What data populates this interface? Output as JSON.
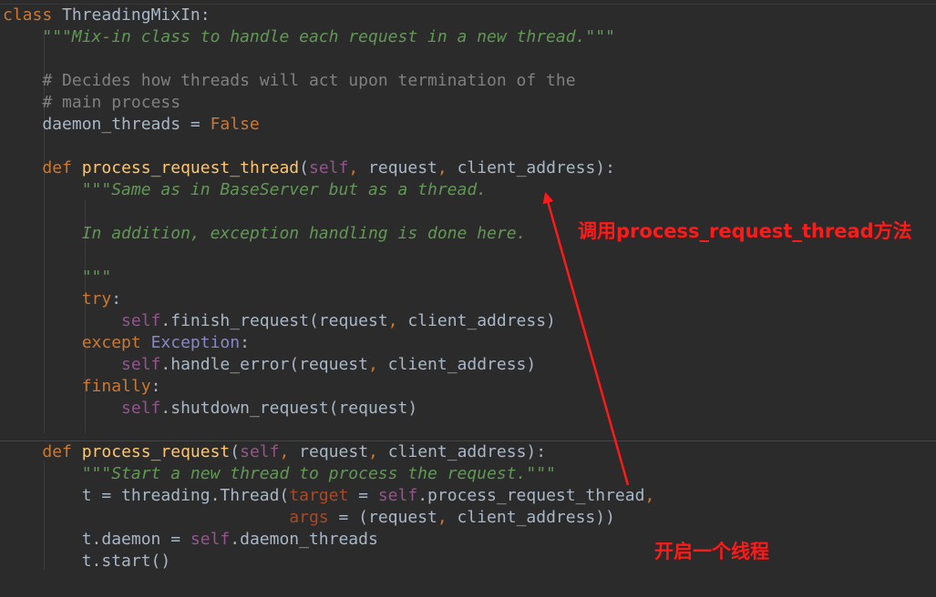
{
  "code": {
    "l1": [
      {
        "c": "kw",
        "t": "class "
      },
      {
        "c": "plain",
        "t": "ThreadingMixIn:"
      }
    ],
    "l2": [
      {
        "c": "plain",
        "t": "    "
      },
      {
        "c": "doc",
        "t": "\"\"\"Mix-in class to handle each request in a new thread.\"\"\""
      }
    ],
    "l3": [],
    "l4": [
      {
        "c": "plain",
        "t": "    "
      },
      {
        "c": "cm",
        "t": "# Decides how threads will act upon termination of the"
      }
    ],
    "l5": [
      {
        "c": "plain",
        "t": "    "
      },
      {
        "c": "cm",
        "t": "# main process"
      }
    ],
    "l6": [
      {
        "c": "plain",
        "t": "    daemon_threads = "
      },
      {
        "c": "kw",
        "t": "False"
      }
    ],
    "l7": [],
    "l8": [
      {
        "c": "plain",
        "t": "    "
      },
      {
        "c": "kw",
        "t": "def "
      },
      {
        "c": "fn",
        "t": "process_request_thread"
      },
      {
        "c": "plain",
        "t": "("
      },
      {
        "c": "slf",
        "t": "self"
      },
      {
        "c": "kw",
        "t": ", "
      },
      {
        "c": "plain",
        "t": "request"
      },
      {
        "c": "kw",
        "t": ", "
      },
      {
        "c": "plain",
        "t": "client_address):"
      }
    ],
    "l9": [
      {
        "c": "plain",
        "t": "        "
      },
      {
        "c": "doc",
        "t": "\"\"\"Same as in BaseServer but as a thread."
      }
    ],
    "l10": [],
    "l11": [
      {
        "c": "plain",
        "t": "        "
      },
      {
        "c": "doc",
        "t": "In addition, exception handling is done here."
      }
    ],
    "l12": [],
    "l13": [
      {
        "c": "plain",
        "t": "        "
      },
      {
        "c": "doc",
        "t": "\"\"\""
      }
    ],
    "l14": [
      {
        "c": "plain",
        "t": "        "
      },
      {
        "c": "kw",
        "t": "try"
      },
      {
        "c": "plain",
        "t": ":"
      }
    ],
    "l15": [
      {
        "c": "plain",
        "t": "            "
      },
      {
        "c": "slf",
        "t": "self"
      },
      {
        "c": "plain",
        "t": ".finish_request(request"
      },
      {
        "c": "kw",
        "t": ", "
      },
      {
        "c": "plain",
        "t": "client_address)"
      }
    ],
    "l16": [
      {
        "c": "plain",
        "t": "        "
      },
      {
        "c": "kw",
        "t": "except "
      },
      {
        "c": "bi",
        "t": "Exception"
      },
      {
        "c": "plain",
        "t": ":"
      }
    ],
    "l17": [
      {
        "c": "plain",
        "t": "            "
      },
      {
        "c": "slf",
        "t": "self"
      },
      {
        "c": "plain",
        "t": ".handle_error(request"
      },
      {
        "c": "kw",
        "t": ", "
      },
      {
        "c": "plain",
        "t": "client_address)"
      }
    ],
    "l18": [
      {
        "c": "plain",
        "t": "        "
      },
      {
        "c": "kw",
        "t": "finally"
      },
      {
        "c": "plain",
        "t": ":"
      }
    ],
    "l19": [
      {
        "c": "plain",
        "t": "            "
      },
      {
        "c": "slf",
        "t": "self"
      },
      {
        "c": "plain",
        "t": ".shutdown_request(request)"
      }
    ],
    "l20": [],
    "l21": [
      {
        "c": "plain",
        "t": "    "
      },
      {
        "c": "kw",
        "t": "def "
      },
      {
        "c": "fn",
        "t": "process_request"
      },
      {
        "c": "plain",
        "t": "("
      },
      {
        "c": "slf",
        "t": "self"
      },
      {
        "c": "kw",
        "t": ", "
      },
      {
        "c": "plain",
        "t": "request"
      },
      {
        "c": "kw",
        "t": ", "
      },
      {
        "c": "plain",
        "t": "client_address):"
      }
    ],
    "l22": [
      {
        "c": "plain",
        "t": "        "
      },
      {
        "c": "doc",
        "t": "\"\"\"Start a new thread to process the request.\"\"\""
      }
    ],
    "l23": [
      {
        "c": "plain",
        "t": "        t = threading.Thread("
      },
      {
        "c": "kwa",
        "t": "target"
      },
      {
        "c": "plain",
        "t": " = "
      },
      {
        "c": "slf",
        "t": "self"
      },
      {
        "c": "plain",
        "t": ".process_request_thread"
      },
      {
        "c": "kw",
        "t": ","
      }
    ],
    "l24": [
      {
        "c": "plain",
        "t": "                             "
      },
      {
        "c": "kwa",
        "t": "args"
      },
      {
        "c": "plain",
        "t": " = (request"
      },
      {
        "c": "kw",
        "t": ", "
      },
      {
        "c": "plain",
        "t": "client_address))"
      }
    ],
    "l25": [
      {
        "c": "plain",
        "t": "        t.daemon = "
      },
      {
        "c": "slf",
        "t": "self"
      },
      {
        "c": "plain",
        "t": ".daemon_threads"
      }
    ],
    "l26": [
      {
        "c": "plain",
        "t": "        t.start()"
      }
    ]
  },
  "annotations": {
    "call_method": "调用process_request_thread方法",
    "start_thread": "开启一个线程"
  },
  "colors": {
    "background": "#2b2b2b",
    "keyword": "#cc7832",
    "function": "#ffc66d",
    "self": "#94558d",
    "docstring": "#629755",
    "comment": "#808080",
    "annotation": "#ff1a1a"
  }
}
